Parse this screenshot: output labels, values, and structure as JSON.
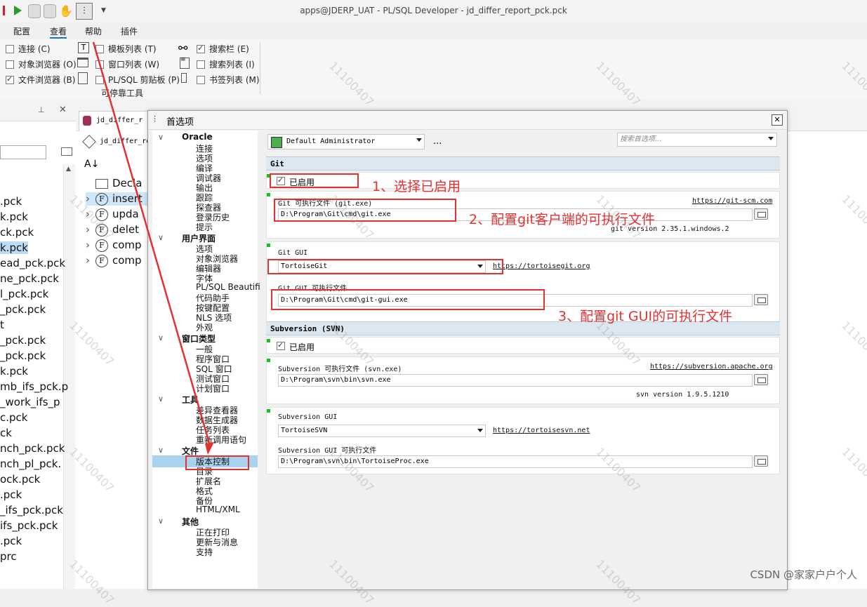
{
  "window": {
    "title": "apps@JDERP_UAT - PL/SQL Developer - jd_differ_report_pck.pck"
  },
  "menu": [
    "配置",
    "查看",
    "帮助",
    "插件"
  ],
  "ribbon": {
    "col1": [
      {
        "label": "连接 (C)",
        "checked": false
      },
      {
        "label": "对象浏览器 (O)",
        "checked": false
      },
      {
        "label": "文件浏览器 (B)",
        "checked": true
      }
    ],
    "col2": [
      {
        "label": "模板列表 (T)",
        "checked": false
      },
      {
        "label": "窗口列表 (W)",
        "checked": false
      },
      {
        "label": "PL/SQL 剪贴板 (P)",
        "checked": false
      }
    ],
    "col3": [
      {
        "label": "搜索栏 (E)",
        "checked": true
      },
      {
        "label": "搜索列表 (I)",
        "checked": false
      },
      {
        "label": "书签列表 (M)",
        "checked": false
      }
    ],
    "group_label": "可停靠工具"
  },
  "left_panel": {
    "items": [
      ".pck",
      "k.pck",
      "ck.pck",
      "k.pck",
      "ead_pck.pck",
      "ne_pck.pck",
      "l_pck.pck",
      "_pck.pck",
      "t",
      "_pck.pck",
      "_pck.pck",
      "k.pck",
      "mb_ifs_pck.p",
      "_work_ifs_p",
      "c.pck",
      "ck",
      "nch_pck.pck",
      "nch_pl_pck.",
      "ock.pck",
      ".pck",
      "_ifs_pck.pck",
      "ifs_pck.pck",
      ".pck",
      "prc"
    ]
  },
  "editor": {
    "tab1": "jd_differ_r",
    "tab2": "jd_differ_re",
    "tree": [
      {
        "icon": "folder",
        "label": "Decla"
      },
      {
        "icon": "F",
        "label": "insert"
      },
      {
        "icon": "F",
        "label": "upda"
      },
      {
        "icon": "F",
        "label": "delet"
      },
      {
        "icon": "F",
        "label": "comp"
      },
      {
        "icon": "F",
        "label": "comp"
      }
    ]
  },
  "dialog": {
    "title": "首选项",
    "search_placeholder": "搜索首选项...",
    "profile": "Default Administrator",
    "profile_more": "...",
    "tree": [
      {
        "header": "Oracle",
        "items": [
          "连接",
          "选项",
          "编译",
          "调试器",
          "输出",
          "跟踪",
          "探查器",
          "登录历史",
          "提示"
        ]
      },
      {
        "header": "用户界面",
        "items": [
          "选项",
          "对象浏览器",
          "编辑器",
          "字体",
          "PL/SQL Beautifi",
          "代码助手",
          "按键配置",
          "NLS 选项",
          "外观"
        ]
      },
      {
        "header": "窗口类型",
        "items": [
          "一般",
          "程序窗口",
          "SQL 窗口",
          "测试窗口",
          "计划窗口"
        ]
      },
      {
        "header": "工具",
        "items": [
          "差异查看器",
          "数据生成器",
          "任务列表",
          "重新调用语句"
        ]
      },
      {
        "header": "文件",
        "items": [
          "版本控制",
          "目录",
          "扩展名",
          "格式",
          "备份",
          "HTML/XML"
        ]
      },
      {
        "header": "其他",
        "items": [
          "正在打印",
          "更新与消息",
          "支持"
        ]
      }
    ],
    "selected_item": "版本控制",
    "git": {
      "section": "Git",
      "enabled_label": "已启用",
      "enabled": true,
      "exe_label": "Git 可执行文件 (git.exe)",
      "exe_link": "https://git-scm.com",
      "exe_path": "D:\\Program\\Git\\cmd\\git.exe",
      "version": "git version 2.35.1.windows.2",
      "gui_label": "Git GUI",
      "gui_value": "TortoiseGit",
      "gui_link": "https://tortoisegit.org",
      "gui_exe_label": "Git GUI 可执行文件",
      "gui_exe_path": "D:\\Program\\Git\\cmd\\git-gui.exe"
    },
    "svn": {
      "section": "Subversion (SVN)",
      "enabled_label": "已启用",
      "enabled": true,
      "exe_label": "Subversion 可执行文件 (svn.exe)",
      "exe_link": "https://subversion.apache.org",
      "exe_path": "D:\\Program\\svn\\bin\\svn.exe",
      "version": "svn version 1.9.5.1210",
      "gui_label": "Subversion GUI",
      "gui_value": "TortoiseSVN",
      "gui_link": "https://tortoisesvn.net",
      "gui_exe_label": "Subversion GUI 可执行文件",
      "gui_exe_path": "D:\\Program\\svn\\bin\\TortoiseProc.exe"
    }
  },
  "annotations": {
    "a1": "1、选择已启用",
    "a2": "2、配置git客户端的可执行文件",
    "a3": "3、配置git GUI的可执行文件",
    "color": "#e53030"
  },
  "watermark": "11100407",
  "footer_credit": "CSDN @家家户户个人"
}
